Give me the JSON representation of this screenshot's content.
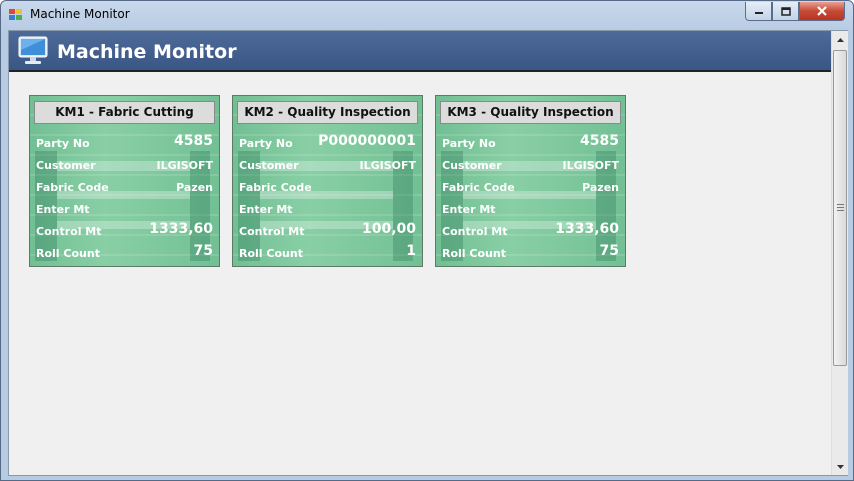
{
  "window": {
    "title": "Machine Monitor"
  },
  "header": {
    "title": "Machine Monitor",
    "icon": "monitor-icon"
  },
  "labels": {
    "party_no": "Party No",
    "customer": "Customer",
    "fabric_code": "Fabric Code",
    "enter_mt": "Enter Mt",
    "control_mt": "Control Mt",
    "roll_count": "Roll Count"
  },
  "cards": [
    {
      "title": "KM1 - Fabric Cutting",
      "party_no": "4585",
      "customer": "ILGISOFT",
      "fabric_code": "Pazen",
      "enter_mt": "",
      "control_mt": "1333,60",
      "roll_count": "75"
    },
    {
      "title": "KM2 - Quality Inspection",
      "party_no": "P000000001",
      "customer": "ILGISOFT",
      "fabric_code": "",
      "enter_mt": "",
      "control_mt": "100,00",
      "roll_count": "1"
    },
    {
      "title": "KM3 - Quality Inspection",
      "party_no": "4585",
      "customer": "ILGISOFT",
      "fabric_code": "Pazen",
      "enter_mt": "",
      "control_mt": "1333,60",
      "roll_count": "75"
    }
  ],
  "colors": {
    "card_bg": "#7fcb9e",
    "header_bar": "#3f5b8a",
    "client_bg": "#f0f0f0"
  }
}
